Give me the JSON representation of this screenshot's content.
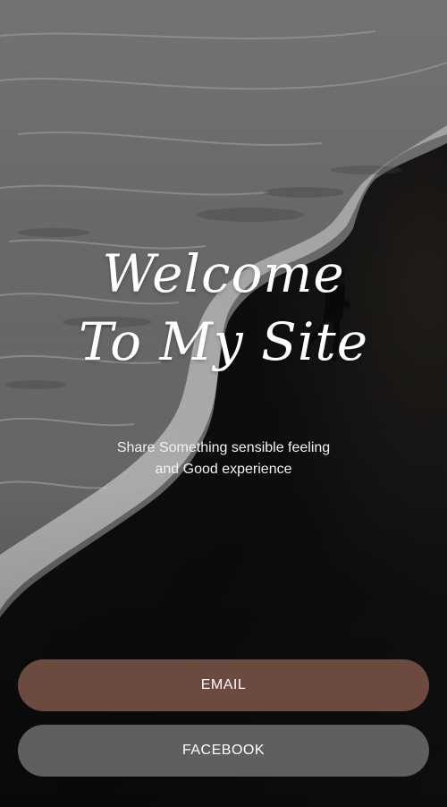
{
  "hero": {
    "title_line1": "Welcome",
    "title_line2": "To My Site",
    "subtitle_line1": "Share Something sensible feeling",
    "subtitle_line2": "and Good experience"
  },
  "actions": {
    "email_label": "EMAIL",
    "facebook_label": "FACEBOOK"
  },
  "colors": {
    "email_button": "#6c4a40",
    "facebook_button": "#5f5f5f",
    "sand": "#0b0b0c",
    "foam": "#cfcfcf"
  }
}
